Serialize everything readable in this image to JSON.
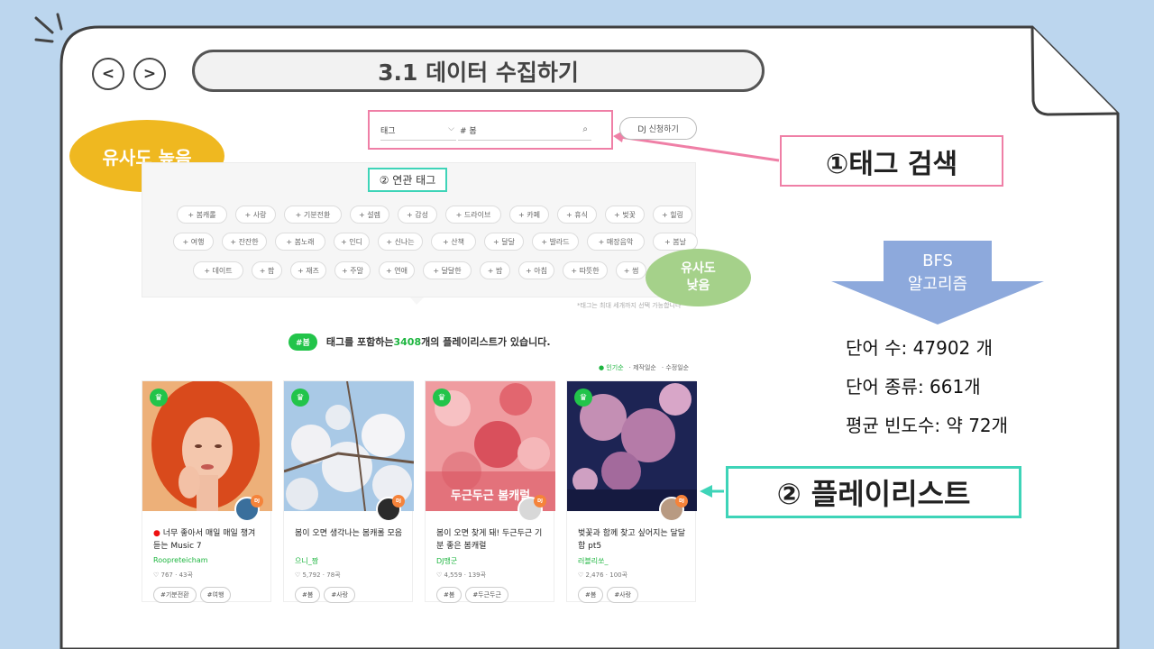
{
  "nav": {
    "back_label": "<",
    "forward_label": ">"
  },
  "slide": {
    "title": "3.1  데이터 수집하기"
  },
  "search": {
    "type_value": "태그",
    "query_value": "# 봄",
    "dj_button_label": "DJ 신청하기"
  },
  "callouts": {
    "tag_search": "①태그 검색",
    "playlist": "② 플레이리스트",
    "high_similarity": "유사도 높음",
    "low_similarity_line1": "유사도",
    "low_similarity_line2": "낮음"
  },
  "tag_panel": {
    "label": "② 연관 태그",
    "note": "*태그는 최대 세개까지 선택 가능합니다",
    "rows": [
      [
        "+ 봄캐롤",
        "+ 사랑",
        "+ 기분전환",
        "+ 설렘",
        "+ 감성",
        "+ 드라이브",
        "+ 카페",
        "+ 휴식",
        "+ 벚꽃",
        "+ 힐링"
      ],
      [
        "+ 여행",
        "+ 잔잔한",
        "+ 봄노래",
        "+ 인디",
        "+ 신나는",
        "+ 산책",
        "+ 달달",
        "+ 발라드",
        "+ 매장음악",
        "+ 봄날"
      ],
      [
        "+ 데이트",
        "+ 팝",
        "+ 재즈",
        "+ 주말",
        "+ 연애",
        "+ 달달한",
        "+ 밤",
        "+ 아침",
        "+ 따뜻한",
        "+ 썸"
      ]
    ]
  },
  "results": {
    "tag_badge": "#봄",
    "prefix": "태그를 포함하는 ",
    "count": "3408",
    "suffix": "개의 플레이리스트가 있습니다.",
    "sort": [
      "● 인기순",
      "· 제작일순",
      "· 수정일순"
    ]
  },
  "cards": [
    {
      "title_dot": "●",
      "title": "너무 좋아서 매일 매일 챙겨 듣는 Music 7",
      "owner": "Roopreteicham",
      "likes": "♡ 767",
      "count": "43곡",
      "tags": [
        "#기분전환",
        "#여행"
      ],
      "thumb_text": ""
    },
    {
      "title_dot": "",
      "title": "봄이 오면 생각나는 봄캐롤 모음",
      "owner": "으니_짱",
      "likes": "♡ 5,792",
      "count": "78곡",
      "tags": [
        "#봄",
        "#사랑"
      ],
      "thumb_text": ""
    },
    {
      "title_dot": "",
      "title": "봄이 오면 찾게 돼! 두근두근 기분 좋은 봄캐럴",
      "owner": "DJ맹군",
      "likes": "♡ 4,559",
      "count": "139곡",
      "tags": [
        "#봄",
        "#두근두근"
      ],
      "thumb_text": "두근두근 봄캐럴"
    },
    {
      "title_dot": "",
      "title": "벚꽃과 함께 찾고 싶어지는 달달함 pt5",
      "owner": "러블리쏘_",
      "likes": "♡ 2,476",
      "count": "100곡",
      "tags": [
        "#봄",
        "#사랑"
      ],
      "thumb_text": ""
    }
  ],
  "card_badges": {
    "crown": "♛",
    "dj": "DJ"
  },
  "algorithm": {
    "line1": "BFS",
    "line2": "알고리즘"
  },
  "stats": {
    "words": "단어 수: 47902 개",
    "kinds": "단어 종류: 661개",
    "avg": "평균 빈도수: 약 72개"
  },
  "colors": {
    "pink": "#ef7fa6",
    "teal": "#3ed4b8",
    "gold": "#efb820",
    "green": "#a5d18a",
    "blue_arrow": "#8da9dc",
    "brand_green": "#22c44a"
  }
}
